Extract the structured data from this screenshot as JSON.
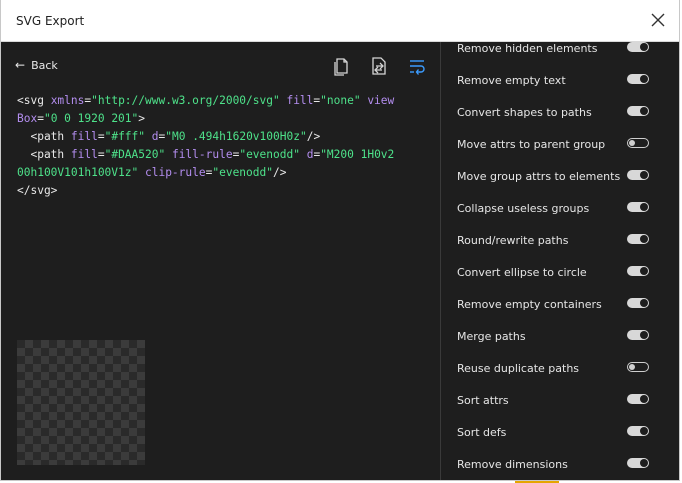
{
  "dialog": {
    "title": "SVG Export"
  },
  "toolbar": {
    "back_label": "Back"
  },
  "code": {
    "line1": {
      "t1": "<svg ",
      "a1": "xmlns",
      "e1": "=",
      "v1": "\"http://www.w3.org/2000/svg\"",
      "a2": " fill",
      "e2": "=",
      "v2": "\"none\"",
      "a3": " view"
    },
    "line2": {
      "a1": "Box",
      "e1": "=",
      "v1": "\"0 0 1920 201\"",
      "t1": ">"
    },
    "line3": {
      "t1": "  <path ",
      "a1": "fill",
      "e1": "=",
      "v1": "\"#fff\"",
      "a2": " d",
      "e2": "=",
      "v2": "\"M0 .494h1620v100H0z\"",
      "t2": "/>"
    },
    "line4": {
      "t1": "  <path ",
      "a1": "fill",
      "e1": "=",
      "v1": "\"#DAA520\"",
      "a2": " fill-rule",
      "e2": "=",
      "v2": "\"evenodd\"",
      "a3": " d",
      "e3": "=",
      "v3": "\"M200 1H0v2"
    },
    "line5": {
      "v1": "00h100V101h100V1z\"",
      "a1": " clip-rule",
      "e1": "=",
      "v2": "\"evenodd\"",
      "t1": "/>"
    },
    "line6": {
      "t1": "</svg>"
    }
  },
  "options": [
    {
      "label": "Remove hidden elements",
      "on": true
    },
    {
      "label": "Remove empty text",
      "on": true
    },
    {
      "label": "Convert shapes to paths",
      "on": true
    },
    {
      "label": "Move attrs to parent group",
      "on": false
    },
    {
      "label": "Move group attrs to elements",
      "on": true
    },
    {
      "label": "Collapse useless groups",
      "on": true
    },
    {
      "label": "Round/rewrite paths",
      "on": true
    },
    {
      "label": "Convert ellipse to circle",
      "on": true
    },
    {
      "label": "Remove empty containers",
      "on": true
    },
    {
      "label": "Merge paths",
      "on": true
    },
    {
      "label": "Reuse duplicate paths",
      "on": false
    },
    {
      "label": "Sort attrs",
      "on": true
    },
    {
      "label": "Sort defs",
      "on": true
    },
    {
      "label": "Remove dimensions",
      "on": true
    }
  ],
  "colors": {
    "accent": "#3b9cff",
    "code_attr": "#b48ef0",
    "code_value": "#4ee28a"
  }
}
